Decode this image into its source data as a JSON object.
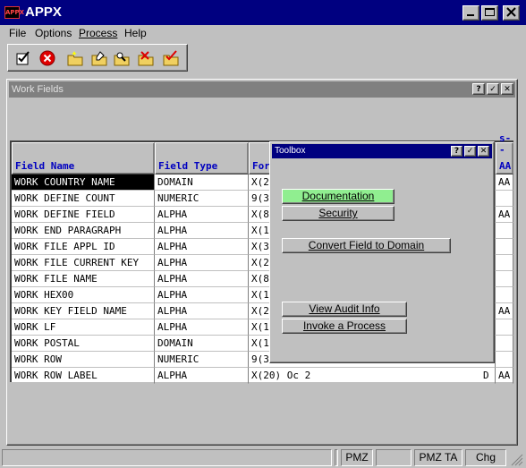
{
  "window": {
    "title": "APPX",
    "logo_text": "APPX"
  },
  "menu": [
    {
      "label": "File"
    },
    {
      "label": "Options"
    },
    {
      "label": "Process"
    },
    {
      "label": "Help"
    }
  ],
  "toolbar": [
    {
      "icon": "checklist-icon"
    },
    {
      "icon": "cancel-icon"
    },
    {
      "icon": "folder-star-icon"
    },
    {
      "icon": "folder-edit-icon"
    },
    {
      "icon": "folder-search-icon"
    },
    {
      "icon": "folder-delete-icon"
    },
    {
      "icon": "folder-check-icon"
    }
  ],
  "work_fields": {
    "title": "Work Fields",
    "columns": [
      {
        "label": "Field Name"
      },
      {
        "label": "Field Type"
      },
      {
        "label": "For"
      },
      {
        "label": "AA"
      }
    ],
    "right_header_fragment": "s--",
    "rows": [
      {
        "name": "WORK COUNTRY NAME",
        "type": "DOMAIN",
        "format": "X(2",
        "flag": "AA",
        "selected": true
      },
      {
        "name": "WORK DEFINE COUNT",
        "type": "NUMERIC",
        "format": "9(3",
        "flag": ""
      },
      {
        "name": "WORK DEFINE FIELD",
        "type": "ALPHA",
        "format": "X(8",
        "flag": "AA"
      },
      {
        "name": "WORK END PARAGRAPH",
        "type": "ALPHA",
        "format": "X(1",
        "flag": ""
      },
      {
        "name": "WORK FILE APPL ID",
        "type": "ALPHA",
        "format": "X(3",
        "flag": ""
      },
      {
        "name": "WORK FILE CURRENT KEY",
        "type": "ALPHA",
        "format": "X(2",
        "flag": ""
      },
      {
        "name": "WORK FILE NAME",
        "type": "ALPHA",
        "format": "X(8",
        "flag": ""
      },
      {
        "name": "WORK HEX00",
        "type": "ALPHA",
        "format": "X(1",
        "flag": ""
      },
      {
        "name": "WORK KEY FIELD NAME",
        "type": "ALPHA",
        "format": "X(2",
        "flag": "AA"
      },
      {
        "name": "WORK LF",
        "type": "ALPHA",
        "format": "X(1",
        "flag": ""
      },
      {
        "name": "WORK POSTAL",
        "type": "DOMAIN",
        "format": "X(1",
        "flag": ""
      },
      {
        "name": "WORK ROW",
        "type": "NUMERIC",
        "format": "9(3",
        "flag": ""
      },
      {
        "name": "WORK ROW LABEL",
        "type": "ALPHA",
        "format": "X(20) Oc 2",
        "format_tail": "D",
        "flag": "AA"
      }
    ]
  },
  "toolbox": {
    "title": "Toolbox",
    "buttons": [
      {
        "label": "Documentation"
      },
      {
        "label": "Security"
      },
      {
        "label": "Convert Field to Domain"
      },
      {
        "label": "View Audit Info"
      },
      {
        "label": "Invoke a Process"
      }
    ]
  },
  "status_bar": {
    "cells": [
      "",
      "",
      "PMZ",
      "",
      "PMZ TA",
      "Chg"
    ]
  },
  "colors": {
    "titlebar": "#000080",
    "header_text": "#0000c0",
    "highlight_button": "#90ee90"
  }
}
